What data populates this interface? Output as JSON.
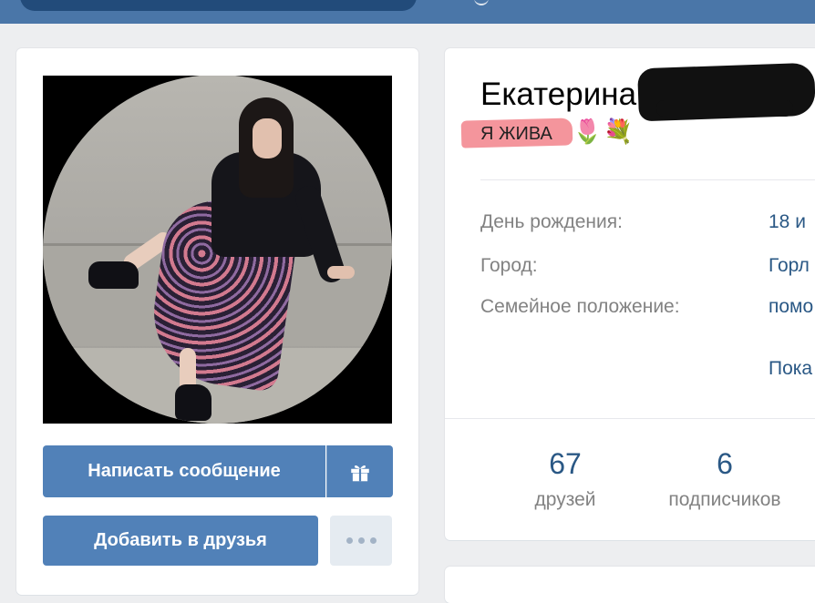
{
  "profile": {
    "name": "Екатерина",
    "status": "Я ЖИВА",
    "status_emoji": [
      "🌷",
      "💐"
    ]
  },
  "actions": {
    "message_label": "Написать сообщение",
    "add_friend_label": "Добавить в друзья",
    "gift_icon": "gift-icon",
    "more_icon": "more-icon"
  },
  "info": {
    "rows": [
      {
        "label": "День рождения:",
        "value": "18 и"
      },
      {
        "label": "Город:",
        "value": "Горл"
      },
      {
        "label": "Семейное положение:",
        "value": "помо"
      }
    ],
    "more_link": "Пока"
  },
  "counters": [
    {
      "value": "67",
      "label": "друзей"
    },
    {
      "value": "6",
      "label": "подписчиков"
    }
  ],
  "colors": {
    "header": "#4a76a8",
    "button": "#5181b8",
    "link": "#2a5885",
    "muted": "#828282",
    "status_highlight": "#f38a91"
  }
}
